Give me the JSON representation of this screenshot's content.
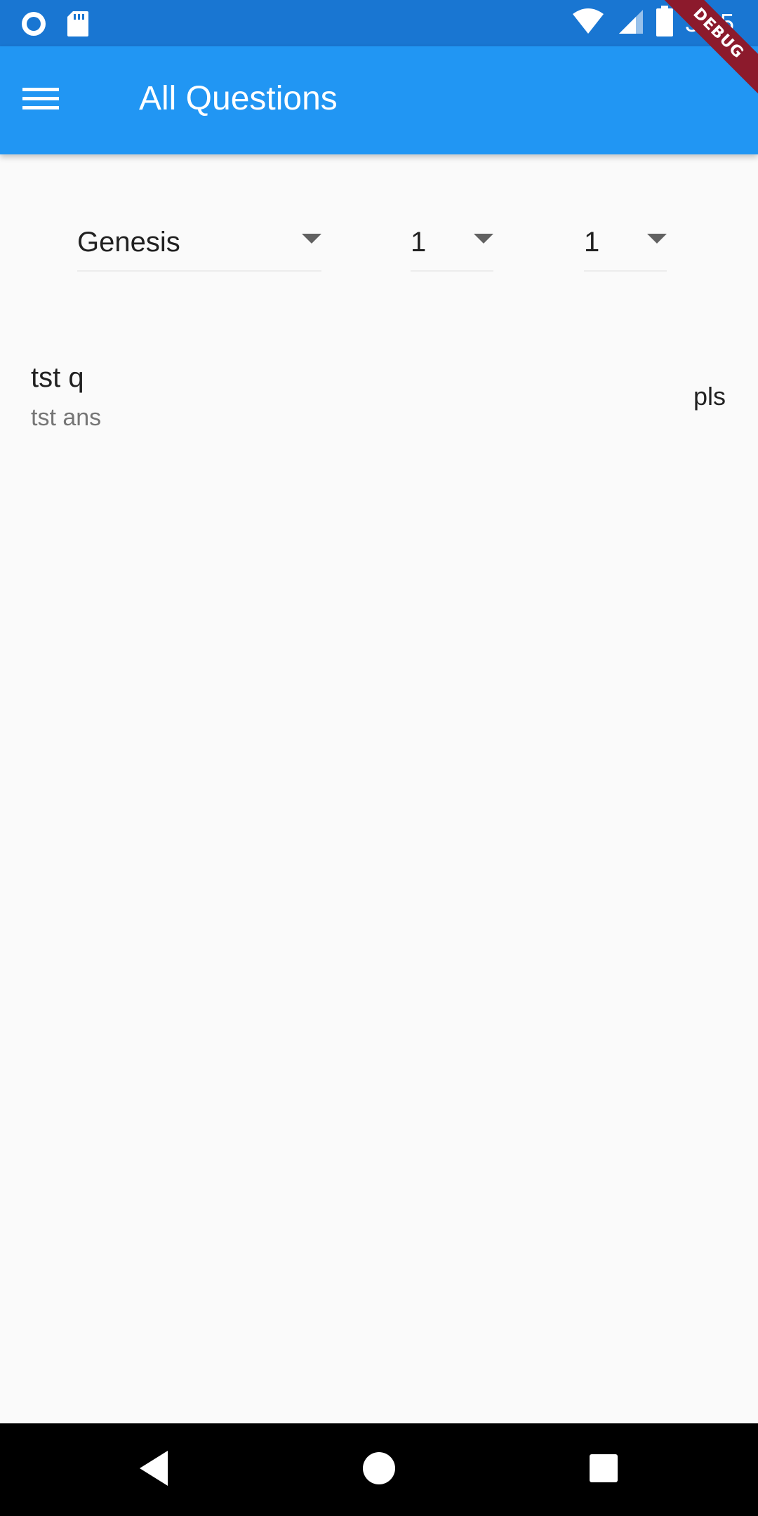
{
  "status_bar": {
    "time": "3:05",
    "icons": [
      "circle-notification-icon",
      "sd-card-icon",
      "wifi-icon",
      "signal-icon",
      "battery-icon"
    ]
  },
  "app_bar": {
    "title": "All Questions",
    "menu_icon": "menu-icon",
    "debug_banner": "DEBUG",
    "color": "#2196f3"
  },
  "filters": {
    "book": {
      "selected": "Genesis"
    },
    "chapter": {
      "selected": "1"
    },
    "verse": {
      "selected": "1"
    }
  },
  "questions": [
    {
      "title": "tst q",
      "subtitle": "tst ans",
      "trailing": "pls"
    }
  ],
  "nav_bar": {
    "icons": [
      "back-icon",
      "home-icon",
      "recents-icon"
    ]
  }
}
